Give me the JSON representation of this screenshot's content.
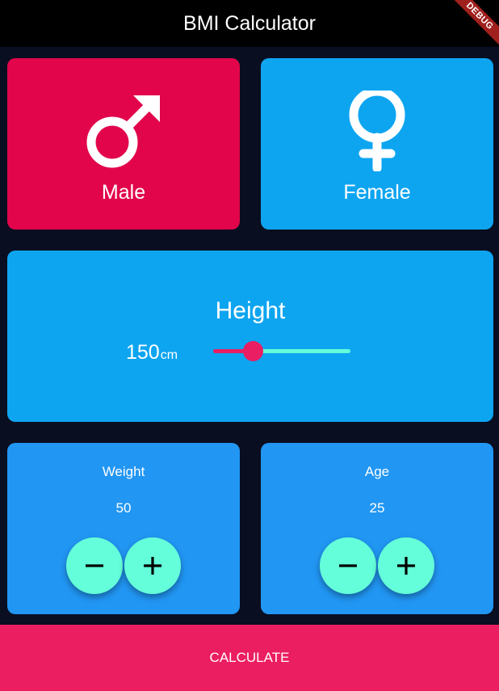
{
  "appbar": {
    "title": "BMI Calculator",
    "debug_banner": "DEBUG"
  },
  "gender": {
    "male": {
      "label": "Male",
      "icon": "male-symbol-icon",
      "color": "#e2054c"
    },
    "female": {
      "label": "Female",
      "icon": "female-symbol-icon",
      "color": "#0ea5f0"
    }
  },
  "height": {
    "title": "Height",
    "value": "150",
    "unit": "cm",
    "slider_fraction": 0.29,
    "active_color": "#e91e63",
    "inactive_color": "#64ffda"
  },
  "weight": {
    "label": "Weight",
    "value": "50",
    "minus_icon": "minus-icon",
    "plus_icon": "plus-icon"
  },
  "age": {
    "label": "Age",
    "value": "25",
    "minus_icon": "minus-icon",
    "plus_icon": "plus-icon"
  },
  "calculate": {
    "label": "CALCULATE",
    "color": "#eb1e62"
  }
}
